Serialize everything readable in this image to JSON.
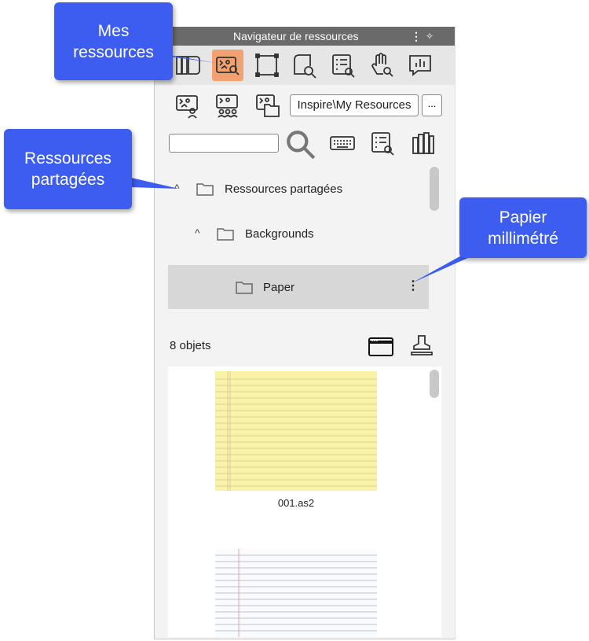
{
  "panel": {
    "title": "Navigateur de ressources",
    "menu_glyph": "⋮",
    "pin_glyph": "✧"
  },
  "toolbar1": {
    "buttons": [
      "library-panels-icon",
      "my-resources-icon",
      "select-frame-icon",
      "page-search-icon",
      "list-search-icon",
      "hand-search-icon",
      "chart-icon"
    ],
    "selected": "my-resources-icon",
    "selected_color": "#f2a170"
  },
  "toolbar2": {
    "path": "Inspire\\My Resources",
    "more_label": "..."
  },
  "search": {
    "value": ""
  },
  "tree": {
    "items": [
      {
        "label": "Ressources partagées",
        "expanded": true
      },
      {
        "label": "Backgrounds",
        "expanded": true
      },
      {
        "label": "Paper",
        "selected": true
      }
    ],
    "more_glyph": "⋮"
  },
  "list": {
    "count": "8 objets",
    "items": [
      {
        "caption": "001.as2",
        "paper": "yellow-lined"
      },
      {
        "caption": "",
        "paper": "white-lined"
      }
    ]
  },
  "callouts": {
    "mes_ressources": "Mes ressources",
    "ressources_partagees": "Ressources partagées",
    "papier_millimetre": "Papier millimétré",
    "color": "#3d5df0"
  },
  "chevron_glyph": "^"
}
